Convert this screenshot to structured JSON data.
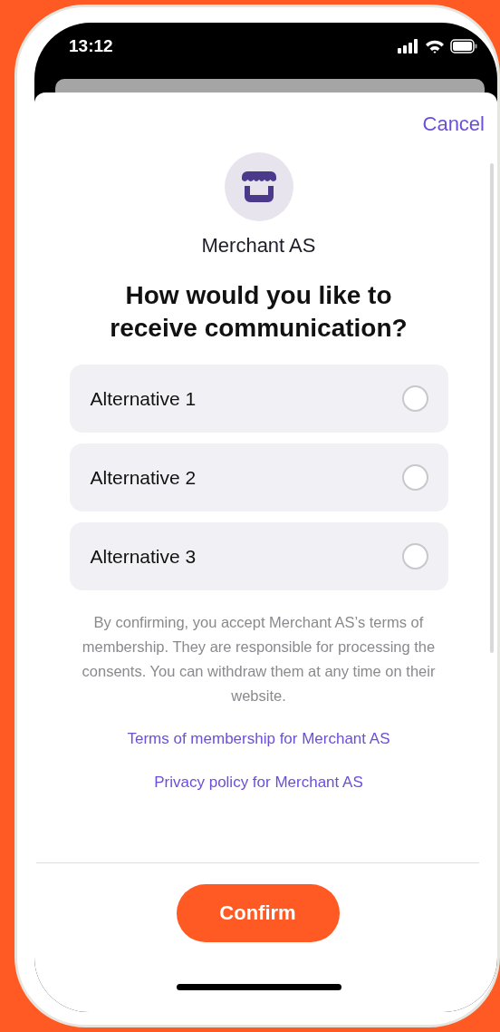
{
  "status_bar": {
    "time": "13:12"
  },
  "sheet": {
    "cancel": "Cancel",
    "merchant_name": "Merchant AS",
    "question": "How would you like to receive communication?",
    "options": [
      {
        "label": "Alternative 1",
        "selected": false
      },
      {
        "label": "Alternative 2",
        "selected": false
      },
      {
        "label": "Alternative 3",
        "selected": false
      }
    ],
    "disclaimer": "By confirming, you accept Merchant AS’s terms of membership. They are responsible for processing the consents. You can withdraw them at any time on their website.",
    "links": [
      "Terms of membership for Merchant AS",
      "Privacy policy for Merchant AS"
    ],
    "confirm": "Confirm"
  }
}
